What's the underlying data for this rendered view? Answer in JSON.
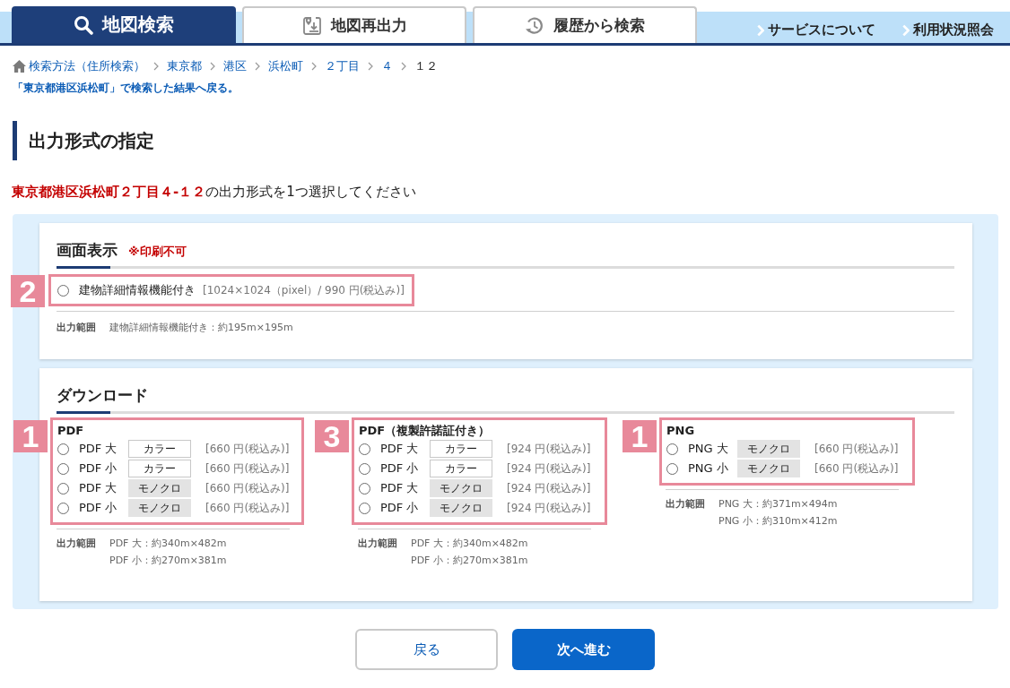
{
  "nav": {
    "tabs": [
      {
        "label": "地図検索",
        "selected": true,
        "kind": "search"
      },
      {
        "label": "地図再出力",
        "selected": false,
        "kind": "reprint"
      },
      {
        "label": "履歴から検索",
        "selected": false,
        "kind": "history"
      }
    ],
    "links": [
      "サービスについて",
      "利用状況照会"
    ]
  },
  "breadcrumb": [
    {
      "label": "検索方法（住所検索）",
      "current": false
    },
    {
      "label": "東京都",
      "current": false
    },
    {
      "label": "港区",
      "current": false
    },
    {
      "label": "浜松町",
      "current": false
    },
    {
      "label": "２丁目",
      "current": false
    },
    {
      "label": "４",
      "current": false
    },
    {
      "label": "１２",
      "current": true
    }
  ],
  "back_link": "「東京都港区浜松町」で検索した結果へ戻る。",
  "heading": "出力形式の指定",
  "instruction": {
    "address": "東京都港区浜松町２丁目４-１２",
    "text": "の出力形式を1つ選択してください"
  },
  "sections": [
    {
      "kind": "single",
      "title": "画面表示",
      "note": "※印刷不可",
      "groups": [
        {
          "annotation": "2",
          "options": [
            {
              "label": "建物詳細情報機能付き",
              "price": "[1024×1024（pixel）/ 990 円(税込み)]",
              "selected": false
            }
          ],
          "range": {
            "label": "出力範囲",
            "values": [
              "建物詳細情報機能付き：約195m×195m"
            ]
          }
        }
      ]
    },
    {
      "kind": "columns",
      "title": "ダウンロード",
      "groups": [
        {
          "annotation": "1",
          "title": "PDF",
          "options": [
            {
              "label": "PDF 大",
              "chip": "カラー",
              "kind": "color",
              "price": "[660 円(税込み)]",
              "selected": false
            },
            {
              "label": "PDF 小",
              "chip": "カラー",
              "kind": "color",
              "price": "[660 円(税込み)]",
              "selected": false
            },
            {
              "label": "PDF 大",
              "chip": "モノクロ",
              "kind": "mono",
              "price": "[660 円(税込み)]",
              "selected": false
            },
            {
              "label": "PDF 小",
              "chip": "モノクロ",
              "kind": "mono",
              "price": "[660 円(税込み)]",
              "selected": false
            }
          ],
          "range": {
            "label": "出力範囲",
            "values": [
              "PDF 大：約340m×482m",
              "PDF 小：約270m×381m"
            ]
          }
        },
        {
          "annotation": "3",
          "title": "PDF（複製許諾証付き）",
          "options": [
            {
              "label": "PDF 大",
              "chip": "カラー",
              "kind": "color",
              "price": "[924 円(税込み)]",
              "selected": false
            },
            {
              "label": "PDF 小",
              "chip": "カラー",
              "kind": "color",
              "price": "[924 円(税込み)]",
              "selected": false
            },
            {
              "label": "PDF 大",
              "chip": "モノクロ",
              "kind": "mono",
              "price": "[924 円(税込み)]",
              "selected": false
            },
            {
              "label": "PDF 小",
              "chip": "モノクロ",
              "kind": "mono",
              "price": "[924 円(税込み)]",
              "selected": false
            }
          ],
          "range": {
            "label": "出力範囲",
            "values": [
              "PDF 大：約340m×482m",
              "PDF 小：約270m×381m"
            ]
          }
        },
        {
          "annotation": "1",
          "title": "PNG",
          "options": [
            {
              "label": "PNG 大",
              "chip": "モノクロ",
              "kind": "mono",
              "price": "[660 円(税込み)]",
              "selected": false
            },
            {
              "label": "PNG 小",
              "chip": "モノクロ",
              "kind": "mono",
              "price": "[660 円(税込み)]",
              "selected": false
            }
          ],
          "range": {
            "label": "出力範囲",
            "values": [
              "PNG 大：約371m×494m",
              "PNG 小：約310m×412m"
            ]
          }
        }
      ]
    }
  ],
  "buttons": [
    {
      "label": "戻る",
      "kind": "secondary"
    },
    {
      "label": "次へ進む",
      "kind": "primary"
    }
  ]
}
